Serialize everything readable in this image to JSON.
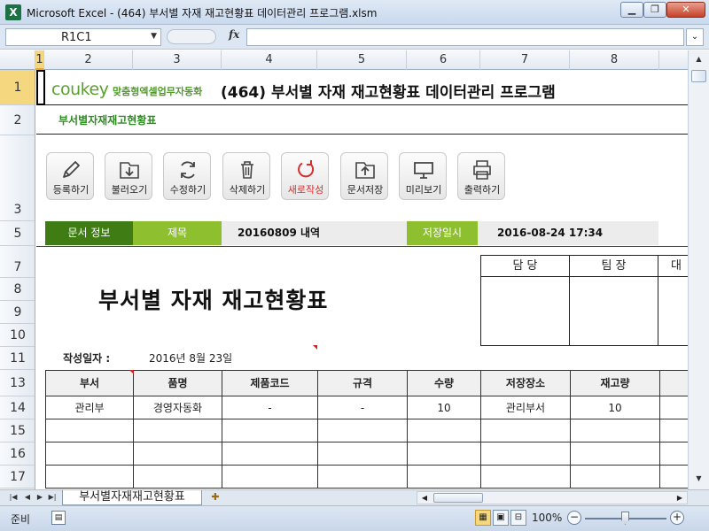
{
  "window": {
    "app_icon": "X",
    "title": "Microsoft Excel - (464) 부서별 자재 재고현황표 데이터관리 프로그램.xlsm",
    "minimize_glyph": "▁",
    "maximize_glyph": "❐",
    "close_glyph": "✕"
  },
  "formula_bar": {
    "name_box": "R1C1",
    "dropdown_glyph": "▼",
    "fx_label": "fx",
    "formula": "",
    "expand_glyph": "⌄"
  },
  "column_headers": [
    "1",
    "2",
    "3",
    "4",
    "5",
    "6",
    "7",
    "8"
  ],
  "row_headers": [
    "1",
    "2",
    "3",
    "5",
    "7",
    "8",
    "9",
    "10",
    "11",
    "13",
    "14",
    "15",
    "16",
    "17"
  ],
  "brand": {
    "logo": "coukey",
    "tagline": "맞춤형엑셀업무자동화",
    "accent": "#5aa12f"
  },
  "doc_title": "(464) 부서별 자재 재고현황표 데이터관리 프로그램",
  "subtitle": "부서별자재재고현황표",
  "toolbar": [
    {
      "id": "register",
      "icon": "pencil-icon",
      "label": "등록하기"
    },
    {
      "id": "load",
      "icon": "download-folder-icon",
      "label": "불러오기"
    },
    {
      "id": "edit",
      "icon": "refresh-icon",
      "label": "수정하기"
    },
    {
      "id": "delete",
      "icon": "trash-icon",
      "label": "삭제하기"
    },
    {
      "id": "new",
      "icon": "reload-red-icon",
      "label": "새로작성"
    },
    {
      "id": "save",
      "icon": "upload-folder-icon",
      "label": "문서저장"
    },
    {
      "id": "preview",
      "icon": "monitor-icon",
      "label": "미리보기"
    },
    {
      "id": "print",
      "icon": "printer-icon",
      "label": "출력하기"
    }
  ],
  "doc_info": {
    "label": "문서 정보",
    "title_label": "제목",
    "title_value": "20160809 내역",
    "saved_label": "저장일시",
    "saved_value": "2016-08-24 17:34",
    "label_color": "#3f7d14",
    "field_color": "#8dbf2e"
  },
  "approval": {
    "headers": [
      "담 당",
      "팀 장",
      "대"
    ]
  },
  "main_title": "부서별 자재 재고현황표",
  "date": {
    "label": "작성일자 :",
    "value": "2016년 8월 23일"
  },
  "table": {
    "headers": [
      "부서",
      "품명",
      "제품코드",
      "규격",
      "수량",
      "저장장소",
      "재고량",
      ""
    ],
    "rows": [
      [
        "관리부",
        "경영자동화",
        "-",
        "-",
        "10",
        "관리부서",
        "10",
        ""
      ],
      [
        "",
        "",
        "",
        "",
        "",
        "",
        "",
        ""
      ],
      [
        "",
        "",
        "",
        "",
        "",
        "",
        "",
        ""
      ],
      [
        "",
        "",
        "",
        "",
        "",
        "",
        "",
        ""
      ]
    ]
  },
  "sheet_tabs": {
    "active": "부서별자재재고현황표",
    "nav": [
      "|◀",
      "◀",
      "▶",
      "▶|"
    ],
    "new_tab_glyph": "✚"
  },
  "status": {
    "ready": "준비",
    "zoom": "100%",
    "minus": "−",
    "plus": "+",
    "views": [
      "▦",
      "▣",
      "⊟"
    ]
  }
}
